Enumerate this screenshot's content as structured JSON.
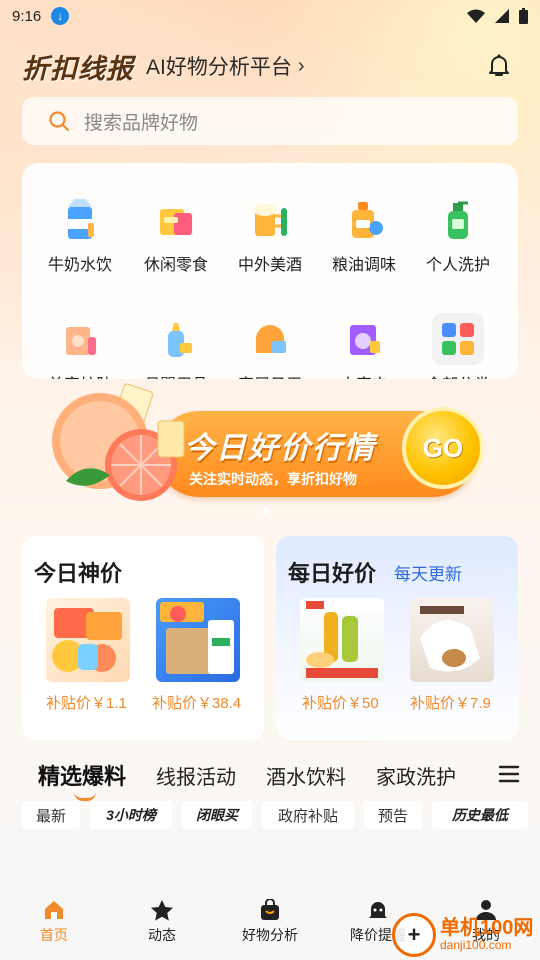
{
  "status_bar": {
    "time": "9:16"
  },
  "header": {
    "logo": "折扣线报",
    "subtitle": "AI好物分析平台"
  },
  "search": {
    "placeholder": "搜索品牌好物"
  },
  "categories": [
    {
      "label": "牛奶水饮",
      "icon": "milk-icon"
    },
    {
      "label": "休闲零食",
      "icon": "snack-icon"
    },
    {
      "label": "中外美酒",
      "icon": "beer-icon"
    },
    {
      "label": "粮油调味",
      "icon": "oil-icon"
    },
    {
      "label": "个人洗护",
      "icon": "soap-icon"
    },
    {
      "label": "美容护肤",
      "icon": "skincare-icon"
    },
    {
      "label": "母婴用品",
      "icon": "baby-bottle-icon"
    },
    {
      "label": "家居日用",
      "icon": "home-icon"
    },
    {
      "label": "大家电",
      "icon": "appliance-icon"
    },
    {
      "label": "全部分类",
      "icon": "grid-icon"
    }
  ],
  "banner": {
    "title": "今日好价行情",
    "subtitle": "关注实时动态，享折扣好物",
    "go": "GO"
  },
  "panels": {
    "left": {
      "title": "今日神价",
      "items": [
        {
          "price": "补贴价￥1.1"
        },
        {
          "price": "补贴价￥38.4"
        }
      ]
    },
    "right": {
      "title": "每日好价",
      "tag": "每天更新",
      "items": [
        {
          "price": "补贴价￥50"
        },
        {
          "price": "补贴价￥7.9"
        }
      ]
    }
  },
  "tabs": [
    "精选爆料",
    "线报活动",
    "酒水饮料",
    "家政洗护"
  ],
  "chips": [
    "最新",
    "3小时榜",
    "闭眼买",
    "政府补贴",
    "预告",
    "历史最低"
  ],
  "nav": [
    {
      "label": "首页",
      "icon": "home-nav-icon"
    },
    {
      "label": "动态",
      "icon": "star-icon"
    },
    {
      "label": "好物分析",
      "icon": "bag-icon"
    },
    {
      "label": "降价提醒",
      "icon": "alarm-icon"
    },
    {
      "label": "我的",
      "icon": "user-icon"
    }
  ],
  "watermark": {
    "name": "单机100网",
    "url": "danji100.com"
  },
  "colors": {
    "accent": "#f08a2a",
    "blue": "#2d6bdc",
    "brand_brown": "#5a3410"
  }
}
